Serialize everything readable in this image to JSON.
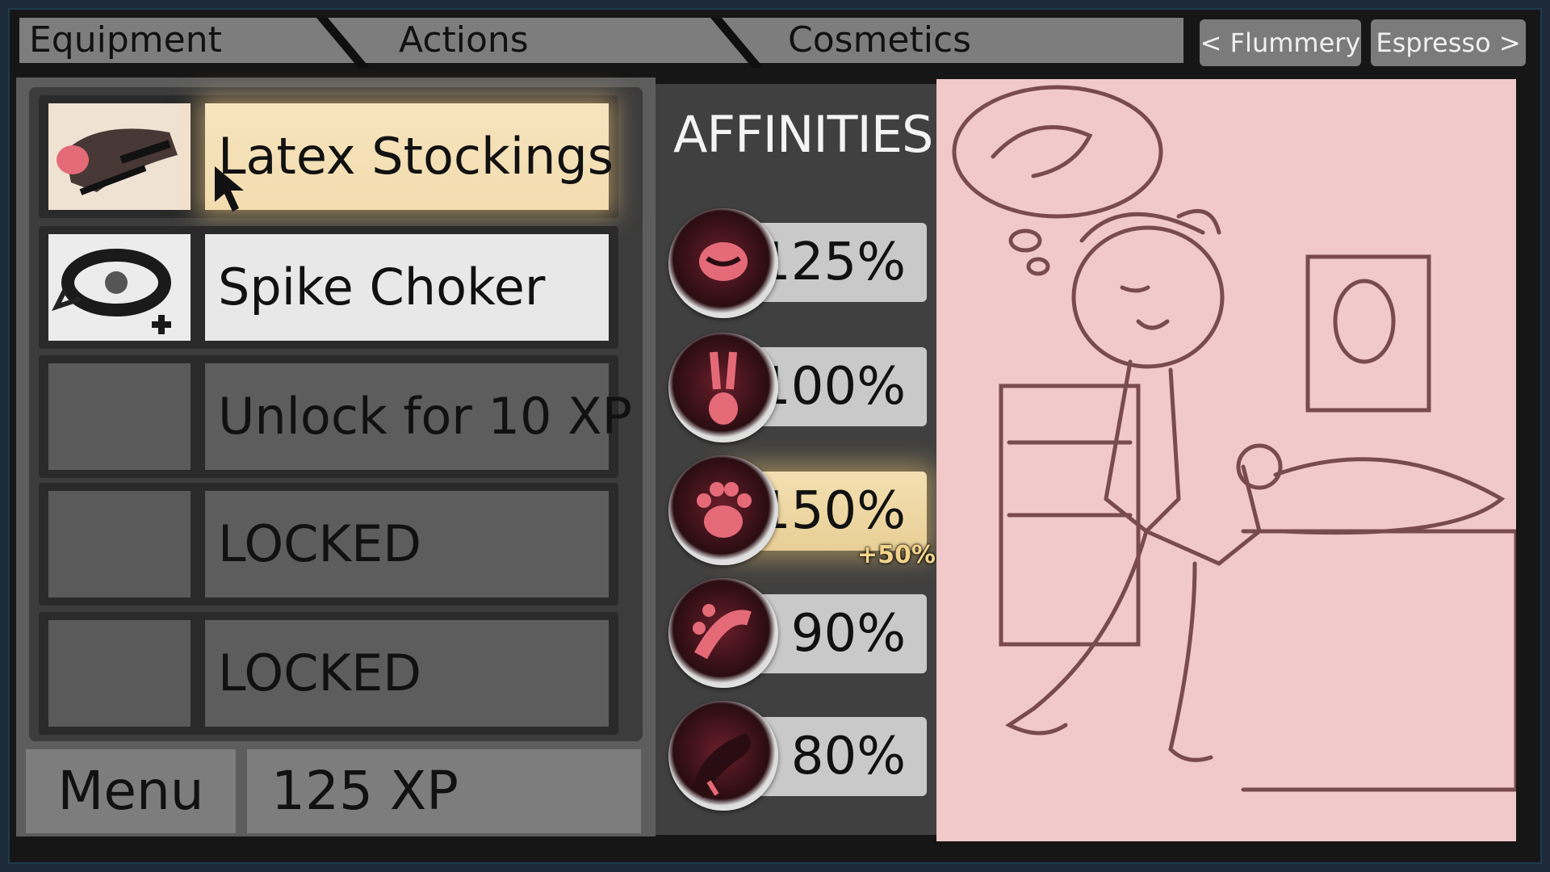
{
  "tabs": [
    {
      "label": "Equipment",
      "active": true
    },
    {
      "label": "Actions",
      "active": false
    },
    {
      "label": "Cosmetics",
      "active": false
    }
  ],
  "character_nav": {
    "prev_label": "< Flummery",
    "next_label": "Espresso >"
  },
  "equipment": {
    "slots": [
      {
        "label": "Latex Stockings",
        "state": "equipped-highlighted",
        "icon": "stockings-icon"
      },
      {
        "label": "Spike Choker",
        "state": "equipped",
        "icon": "choker-icon"
      },
      {
        "label": "Unlock for 10 XP",
        "state": "unlockable",
        "icon": ""
      },
      {
        "label": "LOCKED",
        "state": "locked",
        "icon": ""
      },
      {
        "label": "LOCKED",
        "state": "locked",
        "icon": ""
      }
    ]
  },
  "footer": {
    "menu_label": "Menu",
    "xp_label": "125 XP"
  },
  "affinities": {
    "title": "AFFINITIES",
    "items": [
      {
        "icon": "mouth-icon",
        "value": "125%",
        "highlighted": false
      },
      {
        "icon": "bunny-icon",
        "value": "100%",
        "highlighted": false
      },
      {
        "icon": "paw-icon",
        "value": "150%",
        "highlighted": true,
        "bonus": "+50%"
      },
      {
        "icon": "toes-icon",
        "value": "90%",
        "highlighted": false
      },
      {
        "icon": "tail-icon",
        "value": "80%",
        "highlighted": false
      }
    ]
  },
  "colors": {
    "highlight": "#f2dcaf",
    "art_background": "#f0c9c8",
    "sketch_line": "#7a4b4e"
  }
}
